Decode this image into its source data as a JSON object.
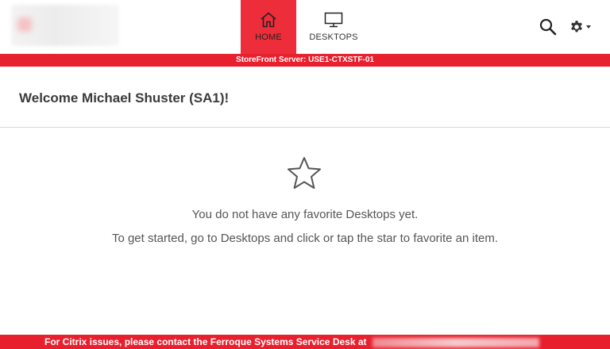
{
  "header": {
    "nav": [
      {
        "label": "HOME",
        "icon": "home-icon",
        "active": true
      },
      {
        "label": "DESKTOPS",
        "icon": "monitor-icon",
        "active": false
      }
    ],
    "search_icon": "search-icon",
    "settings_icon": "gear-icon"
  },
  "server_bar": {
    "text": "StoreFront Server: USE1-CTXSTF-01"
  },
  "welcome": {
    "text": "Welcome Michael Shuster (SA1)!"
  },
  "empty_state": {
    "icon": "star-outline-icon",
    "line1": "You do not have any favorite Desktops yet.",
    "line2": "To get started, go to Desktops and click or tap the star to favorite an item."
  },
  "footer": {
    "text": "For Citrix issues, please contact the Ferroque Systems Service Desk at"
  },
  "colors": {
    "accent": "#e8202e",
    "active_tab": "#ee2d3a"
  }
}
